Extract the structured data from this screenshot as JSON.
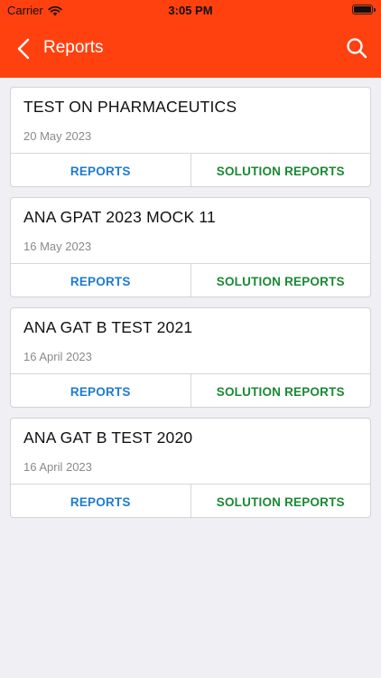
{
  "status_bar": {
    "carrier": "Carrier",
    "time": "3:05 PM"
  },
  "header": {
    "title": "Reports"
  },
  "tests": [
    {
      "name": "TEST ON PHARMACEUTICS",
      "date": "20 May 2023",
      "reports_label": "REPORTS",
      "solution_label": "SOLUTION REPORTS"
    },
    {
      "name": "ANA GPAT 2023 MOCK 11",
      "date": "16 May 2023",
      "reports_label": "REPORTS",
      "solution_label": "SOLUTION REPORTS"
    },
    {
      "name": "ANA GAT B TEST 2021",
      "date": "16 April 2023",
      "reports_label": "REPORTS",
      "solution_label": "SOLUTION REPORTS"
    },
    {
      "name": "ANA GAT B TEST 2020",
      "date": "16 April 2023",
      "reports_label": "REPORTS",
      "solution_label": "SOLUTION REPORTS"
    }
  ],
  "colors": {
    "brand": "#ff4110",
    "reports": "#1e7bd4",
    "solution": "#1a8a34",
    "background": "#efeff4"
  },
  "icons": {
    "back": "chevron-left-icon",
    "search": "search-icon",
    "wifi": "wifi-icon",
    "battery": "battery-icon"
  }
}
